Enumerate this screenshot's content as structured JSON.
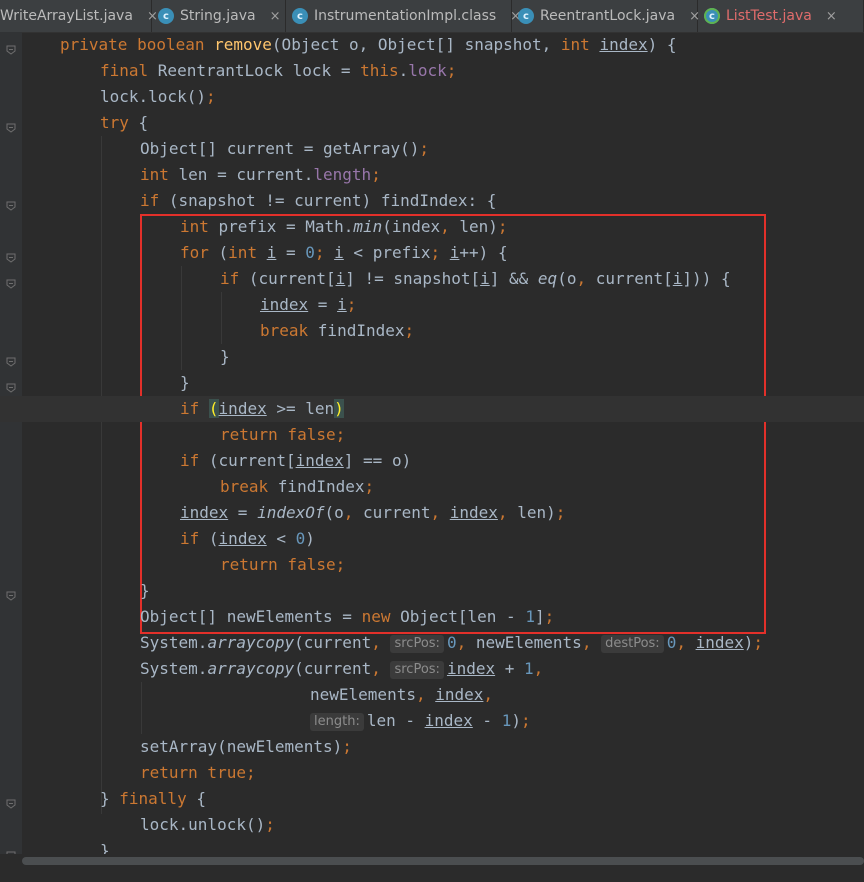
{
  "tabs": [
    {
      "label": "WriteArrayList.java",
      "icon": "java-file-icon"
    },
    {
      "label": "String.java",
      "icon": "class-c-icon"
    },
    {
      "label": "InstrumentationImpl.class",
      "icon": "class-c-icon"
    },
    {
      "label": "ReentrantLock.java",
      "icon": "class-c-icon"
    },
    {
      "label": "ListTest.java",
      "icon": "runnable-class-icon"
    }
  ],
  "tab_close_glyph": "×",
  "colors": {
    "keyword": "#cc7832",
    "method": "#ffc66d",
    "field": "#9876aa",
    "number": "#6897bb",
    "text": "#a9b7c6",
    "background": "#2b2b2b",
    "highlight_box": "#e3302a"
  },
  "code": [
    {
      "n": 1,
      "indent": 60,
      "tokens": [
        [
          "kw",
          "private boolean "
        ],
        [
          "fn",
          "remove"
        ],
        [
          "",
          "(Object o, Object[] snapshot, "
        ],
        [
          "kw",
          "int "
        ],
        [
          "ul",
          "index"
        ],
        [
          "",
          ") {"
        ]
      ]
    },
    {
      "n": 2,
      "indent": 100,
      "tokens": [
        [
          "kw",
          "final "
        ],
        [
          "",
          "ReentrantLock lock = "
        ],
        [
          "kw",
          "this"
        ],
        [
          "",
          "."
        ],
        [
          "fld",
          "lock"
        ],
        [
          "kw",
          ";"
        ]
      ]
    },
    {
      "n": 3,
      "indent": 100,
      "tokens": [
        [
          "",
          "lock.lock()"
        ],
        [
          "kw",
          ";"
        ]
      ]
    },
    {
      "n": 4,
      "indent": 100,
      "tokens": [
        [
          "kw",
          "try "
        ],
        [
          "",
          "{"
        ]
      ]
    },
    {
      "n": 5,
      "indent": 140,
      "tokens": [
        [
          "",
          "Object[] current = getArray()"
        ],
        [
          "kw",
          ";"
        ]
      ]
    },
    {
      "n": 6,
      "indent": 140,
      "tokens": [
        [
          "kw",
          "int "
        ],
        [
          "",
          "len = current."
        ],
        [
          "fld",
          "length"
        ],
        [
          "kw",
          ";"
        ]
      ]
    },
    {
      "n": 7,
      "indent": 140,
      "tokens": [
        [
          "kw",
          "if "
        ],
        [
          "",
          "(snapshot != current) findIndex: {"
        ]
      ]
    },
    {
      "n": 8,
      "indent": 180,
      "tokens": [
        [
          "kw",
          "int "
        ],
        [
          "",
          "prefix = Math."
        ],
        [
          "it",
          "min"
        ],
        [
          "",
          "(index"
        ],
        [
          "kw",
          ", "
        ],
        [
          "",
          "len)"
        ],
        [
          "kw",
          ";"
        ]
      ]
    },
    {
      "n": 9,
      "indent": 180,
      "tokens": [
        [
          "kw",
          "for "
        ],
        [
          "",
          "("
        ],
        [
          "kw",
          "int "
        ],
        [
          "ul",
          "i"
        ],
        [
          "",
          " = "
        ],
        [
          "num",
          "0"
        ],
        [
          "kw",
          "; "
        ],
        [
          "ul",
          "i"
        ],
        [
          "",
          " < prefix"
        ],
        [
          "kw",
          "; "
        ],
        [
          "ul",
          "i"
        ],
        [
          "",
          "++) {"
        ]
      ]
    },
    {
      "n": 10,
      "indent": 220,
      "tokens": [
        [
          "kw",
          "if "
        ],
        [
          "",
          "(current["
        ],
        [
          "ul",
          "i"
        ],
        [
          "",
          "] != snapshot["
        ],
        [
          "ul",
          "i"
        ],
        [
          "",
          "] && "
        ],
        [
          "it",
          "eq"
        ],
        [
          "",
          "(o"
        ],
        [
          "kw",
          ", "
        ],
        [
          "",
          "current["
        ],
        [
          "ul",
          "i"
        ],
        [
          "",
          "])) {"
        ]
      ]
    },
    {
      "n": 11,
      "indent": 260,
      "tokens": [
        [
          "ul",
          "index"
        ],
        [
          "",
          " = "
        ],
        [
          "ul",
          "i"
        ],
        [
          "kw",
          ";"
        ]
      ]
    },
    {
      "n": 12,
      "indent": 260,
      "tokens": [
        [
          "kw",
          "break "
        ],
        [
          "",
          "findIndex"
        ],
        [
          "kw",
          ";"
        ]
      ]
    },
    {
      "n": 13,
      "indent": 220,
      "tokens": [
        [
          "",
          "}"
        ]
      ]
    },
    {
      "n": 14,
      "indent": 180,
      "tokens": [
        [
          "",
          "}"
        ]
      ]
    },
    {
      "n": 15,
      "indent": 180,
      "hl": true,
      "tokens": [
        [
          "kw",
          "if "
        ],
        [
          "brm",
          "("
        ],
        [
          "ul",
          "index"
        ],
        [
          "",
          " >= len"
        ],
        [
          "brm",
          ")"
        ]
      ]
    },
    {
      "n": 16,
      "indent": 220,
      "tokens": [
        [
          "kw",
          "return false;"
        ]
      ]
    },
    {
      "n": 17,
      "indent": 180,
      "tokens": [
        [
          "kw",
          "if "
        ],
        [
          "",
          "(current["
        ],
        [
          "ul",
          "index"
        ],
        [
          "",
          "] == o)"
        ]
      ]
    },
    {
      "n": 18,
      "indent": 220,
      "tokens": [
        [
          "kw",
          "break "
        ],
        [
          "",
          "findIndex"
        ],
        [
          "kw",
          ";"
        ]
      ]
    },
    {
      "n": 19,
      "indent": 180,
      "tokens": [
        [
          "ul",
          "index"
        ],
        [
          "",
          " = "
        ],
        [
          "it",
          "indexOf"
        ],
        [
          "",
          "(o"
        ],
        [
          "kw",
          ", "
        ],
        [
          "",
          "current"
        ],
        [
          "kw",
          ", "
        ],
        [
          "ul",
          "index"
        ],
        [
          "kw",
          ", "
        ],
        [
          "",
          "len)"
        ],
        [
          "kw",
          ";"
        ]
      ]
    },
    {
      "n": 20,
      "indent": 180,
      "tokens": [
        [
          "kw",
          "if "
        ],
        [
          "",
          "("
        ],
        [
          "ul",
          "index"
        ],
        [
          "",
          " < "
        ],
        [
          "num",
          "0"
        ],
        [
          "",
          ")"
        ]
      ]
    },
    {
      "n": 21,
      "indent": 220,
      "tokens": [
        [
          "kw",
          "return false;"
        ]
      ]
    },
    {
      "n": 22,
      "indent": 140,
      "tokens": [
        [
          "",
          "}"
        ]
      ]
    },
    {
      "n": 23,
      "indent": 140,
      "tokens": [
        [
          "",
          "Object[] newElements = "
        ],
        [
          "kw",
          "new "
        ],
        [
          "",
          "Object[len - "
        ],
        [
          "num",
          "1"
        ],
        [
          "",
          "]"
        ],
        [
          "kw",
          ";"
        ]
      ]
    },
    {
      "n": 24,
      "indent": 140,
      "tokens": [
        [
          "",
          "System."
        ],
        [
          "it",
          "arraycopy"
        ],
        [
          "",
          "(current"
        ],
        [
          "kw",
          ", "
        ],
        [
          "hint",
          "srcPos:"
        ],
        [
          "num",
          "0"
        ],
        [
          "kw",
          ", "
        ],
        [
          "",
          "newElements"
        ],
        [
          "kw",
          ", "
        ],
        [
          "hint",
          "destPos:"
        ],
        [
          "num",
          "0"
        ],
        [
          "kw",
          ", "
        ],
        [
          "ul",
          "index"
        ],
        [
          "",
          ")"
        ],
        [
          "kw",
          ";"
        ]
      ]
    },
    {
      "n": 25,
      "indent": 140,
      "tokens": [
        [
          "",
          "System."
        ],
        [
          "it",
          "arraycopy"
        ],
        [
          "",
          "(current"
        ],
        [
          "kw",
          ", "
        ],
        [
          "hint",
          "srcPos:"
        ],
        [
          "ul",
          "index"
        ],
        [
          "",
          " + "
        ],
        [
          "num",
          "1"
        ],
        [
          "kw",
          ","
        ]
      ]
    },
    {
      "n": 26,
      "indent": 310,
      "tokens": [
        [
          "",
          "newElements"
        ],
        [
          "kw",
          ", "
        ],
        [
          "ul",
          "index"
        ],
        [
          "kw",
          ","
        ]
      ]
    },
    {
      "n": 27,
      "indent": 310,
      "tokens": [
        [
          "hint",
          "length:"
        ],
        [
          "",
          "len - "
        ],
        [
          "ul",
          "index"
        ],
        [
          "",
          " - "
        ],
        [
          "num",
          "1"
        ],
        [
          "",
          ")"
        ],
        [
          "kw",
          ";"
        ]
      ]
    },
    {
      "n": 28,
      "indent": 140,
      "tokens": [
        [
          "",
          "setArray(newElements)"
        ],
        [
          "kw",
          ";"
        ]
      ]
    },
    {
      "n": 29,
      "indent": 140,
      "tokens": [
        [
          "kw",
          "return true;"
        ]
      ]
    },
    {
      "n": 30,
      "indent": 100,
      "tokens": [
        [
          "",
          "} "
        ],
        [
          "kw",
          "finally "
        ],
        [
          "",
          "{"
        ]
      ]
    },
    {
      "n": 31,
      "indent": 140,
      "tokens": [
        [
          "",
          "lock.unlock()"
        ],
        [
          "kw",
          ";"
        ]
      ]
    },
    {
      "n": 32,
      "indent": 100,
      "tokens": [
        [
          "",
          "}"
        ]
      ]
    }
  ]
}
